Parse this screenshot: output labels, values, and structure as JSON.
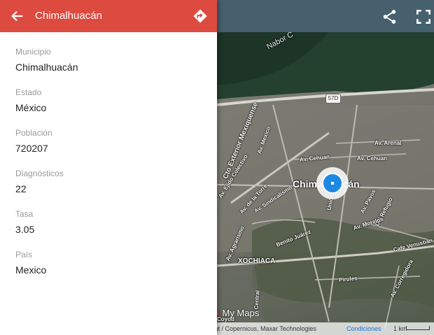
{
  "panel": {
    "title": "Chimalhuacán",
    "fields": [
      {
        "label": "Municipio",
        "value": "Chimalhuacán"
      },
      {
        "label": "Estado",
        "value": "México"
      },
      {
        "label": "Población",
        "value": "720207"
      },
      {
        "label": "Diagnósticos",
        "value": "22"
      },
      {
        "label": "Tasa",
        "value": "3.05"
      },
      {
        "label": "País",
        "value": "Mexico"
      }
    ],
    "icons": {
      "back": "arrow-left-icon",
      "directions": "directions-icon"
    },
    "header_color": "#dd4a3f"
  },
  "map": {
    "toolbar_icons": {
      "share": "share-icon",
      "fullscreen": "fullscreen-icon"
    },
    "labels": {
      "lake": "Nabor C",
      "highway": "57D",
      "ring_road": "Cto Exterior Mexiquense",
      "av_mexico": "Av. Mexico",
      "av_arenal": "Av. Arenal",
      "av_cehuan_1": "Av. Cehuan",
      "av_cehuan_2": "Av. Cehuan",
      "ejido": "Av. Ejido Colectivo",
      "la_torre": "Av. de la Torre",
      "sindicalismo": "Av. Sindicalismo",
      "city": "Chimalhuacán",
      "union": "Unión",
      "av_pavos": "Av. Pavos",
      "del_refugio": "Del Refugio",
      "av_morelos": "Av. Morelos",
      "benito_juarez": "Benito Juárez",
      "av_agrarismo": "Av. Agrarismo",
      "cafe_venustiano": "Cafe Venustian",
      "xochiaca": "XOCHIACA",
      "central": "Central",
      "pirules": "Pirules",
      "corregidora": "Av. Corregidora",
      "coyotl": "Coyotl"
    },
    "attribution": "sat / Copernicus, Maxar Technologies",
    "conditions_link": "Condiciones",
    "scale": "1 km",
    "mymaps": "My Maps",
    "accent_color": "#1e88e5"
  }
}
